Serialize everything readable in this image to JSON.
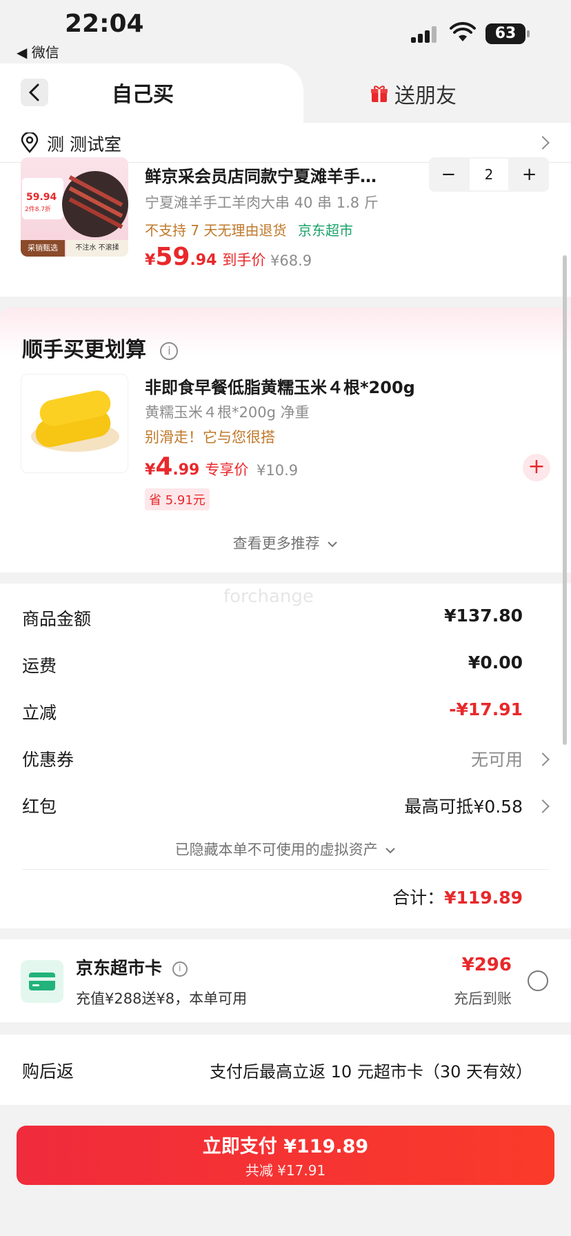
{
  "status_bar": {
    "time": "22:04",
    "back_app": "◀ 微信",
    "battery": "63"
  },
  "tabs": {
    "self": "自己买",
    "gift": "送朋友"
  },
  "address": {
    "text": "测 测试室"
  },
  "product": {
    "title": "鲜京采会员店同款宁夏滩羊手…",
    "subtitle": "宁夏滩羊手工羊肉大串 40 串 1.8 斤",
    "warning": "不支持 7 天无理由退货",
    "store_tag": "京东超市",
    "price_symbol": "¥",
    "price_int": "59",
    "price_dec": ".94",
    "price_label": "到手价",
    "orig_price": "¥68.9",
    "quantity": "2",
    "minus": "−",
    "plus": "+",
    "thumb_text": {
      "badge": "59.94",
      "sub": "2件8.7折",
      "left": "采销甄选",
      "right": "不注水 不滚揉"
    }
  },
  "recommend": {
    "title": "顺手买更划算",
    "item": {
      "title": "非即食早餐低脂黄糯玉米４根*200g",
      "subtitle": "黄糯玉米４根*200g 净重",
      "hint": "别滑走！它与您很搭",
      "price_symbol": "¥",
      "price_int": "4",
      "price_dec": ".99",
      "price_label": "专享价",
      "orig_price": "¥10.9",
      "save": "省 5.91元"
    },
    "more": "查看更多推荐"
  },
  "summary": {
    "watermark": "forchange",
    "rows": [
      {
        "label": "商品金额",
        "value": "¥137.80"
      },
      {
        "label": "运费",
        "value": "¥0.00"
      },
      {
        "label": "立减",
        "value": "-¥17.91"
      },
      {
        "label": "优惠券",
        "value": "无可用"
      },
      {
        "label": "红包",
        "value": "最高可抵¥0.58"
      }
    ],
    "hidden_assets": "已隐藏本单不可使用的虚拟资产",
    "total_label": "合计：",
    "total_value": "¥119.89"
  },
  "market_card": {
    "title": "京东超市卡",
    "desc": "充值¥288送¥8，本单可用",
    "amount": "¥296",
    "note": "充后到账"
  },
  "rebate": {
    "label": "购后返",
    "text": "支付后最高立返 10 元超市卡（30 天有效）"
  },
  "pay_button": {
    "main": "立即支付 ¥119.89",
    "sub": "共减 ¥17.91"
  },
  "colors": {
    "accent": "#e8282b",
    "green": "#1aa36a",
    "warn": "#c0782a"
  }
}
